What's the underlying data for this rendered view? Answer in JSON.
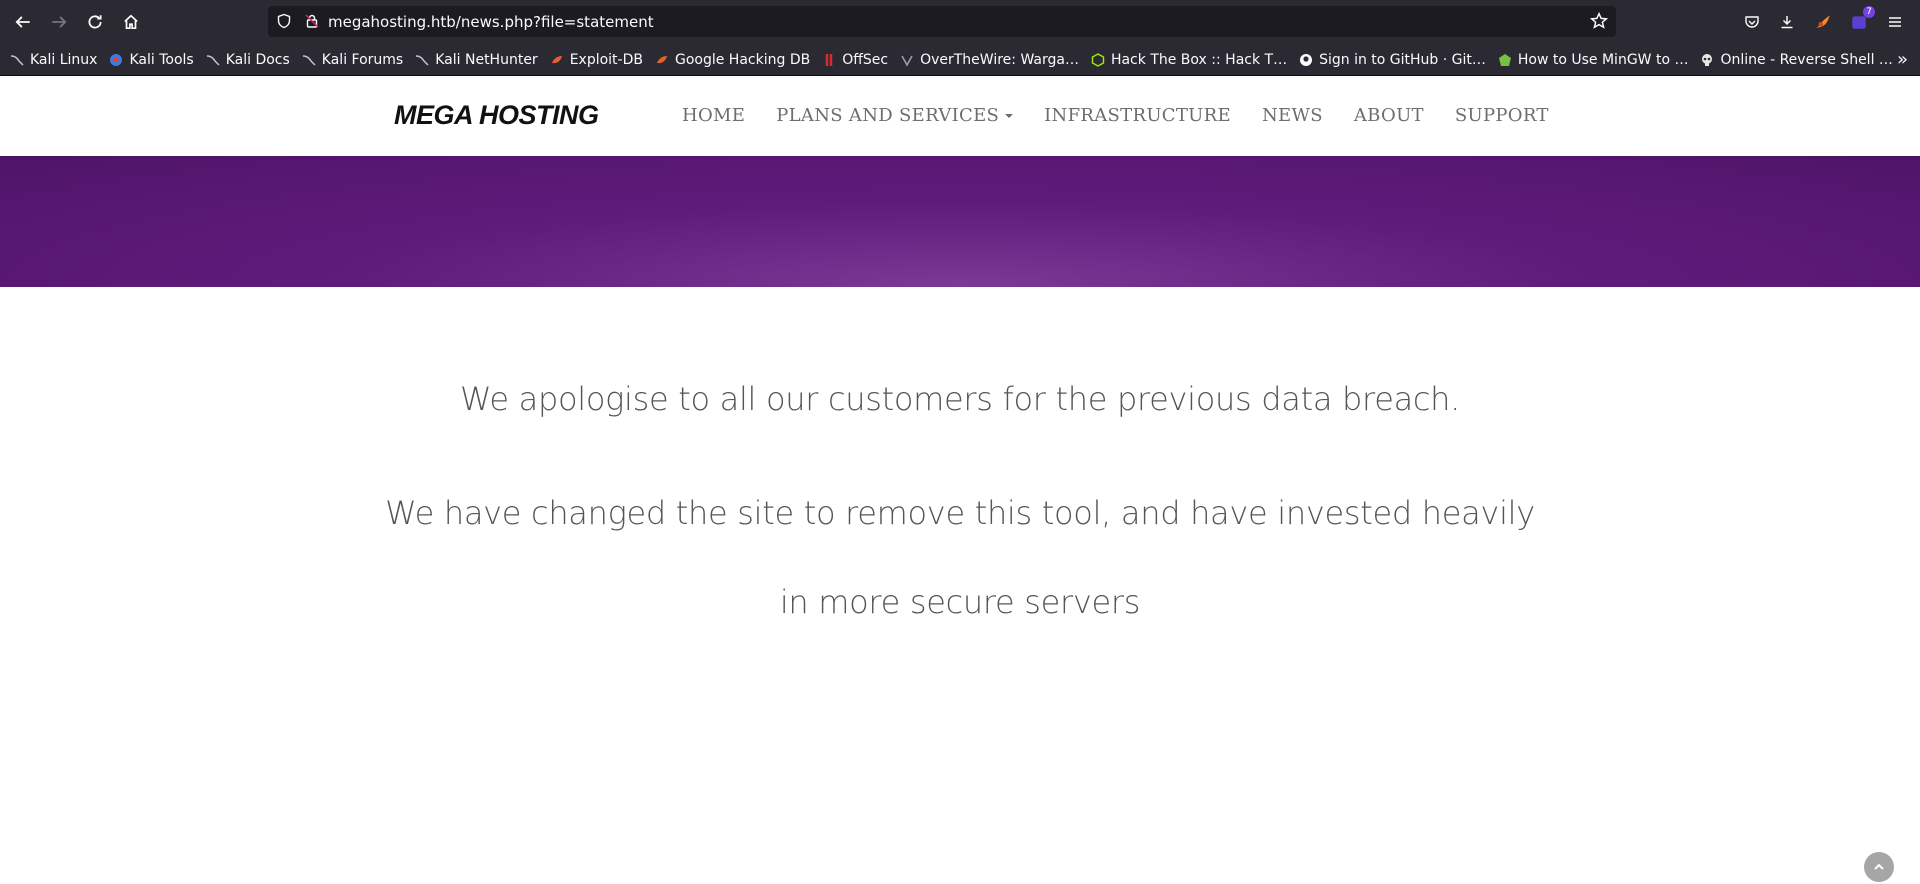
{
  "browser": {
    "url": "megahosting.htb/news.php?file=statement",
    "extensions_badge": "7",
    "bookmarks": [
      {
        "label": "Kali Linux",
        "icon": "kali-dragon-icon"
      },
      {
        "label": "Kali Tools",
        "icon": "kali-tools-icon"
      },
      {
        "label": "Kali Docs",
        "icon": "kali-dragon-icon"
      },
      {
        "label": "Kali Forums",
        "icon": "kali-dragon-icon"
      },
      {
        "label": "Kali NetHunter",
        "icon": "kali-dragon-icon"
      },
      {
        "label": "Exploit-DB",
        "icon": "exploit-db-icon"
      },
      {
        "label": "Google Hacking DB",
        "icon": "exploit-db-icon"
      },
      {
        "label": "OffSec",
        "icon": "offsec-icon"
      },
      {
        "label": "OverTheWire: Warga…",
        "icon": "overthewire-icon"
      },
      {
        "label": "Hack The Box :: Hack T…",
        "icon": "hackthebox-icon"
      },
      {
        "label": "Sign in to GitHub · Git…",
        "icon": "github-icon"
      },
      {
        "label": "How to Use MinGW to …",
        "icon": "mingw-icon"
      },
      {
        "label": "Online - Reverse Shell …",
        "icon": "skull-icon"
      }
    ]
  },
  "site": {
    "logo": "MEGA HOSTING",
    "nav": {
      "home": "HOME",
      "plans": "PLANS AND SERVICES",
      "infrastructure": "INFRASTRUCTURE",
      "news": "NEWS",
      "about": "ABOUT",
      "support": "SUPPORT"
    },
    "banner_color": "#5f1c7b"
  },
  "content": {
    "line1": "We apologise to all our customers for the previous data breach.",
    "line2": "We have changed the site to remove this tool, and have invested heavily",
    "line3": "in more secure servers"
  }
}
